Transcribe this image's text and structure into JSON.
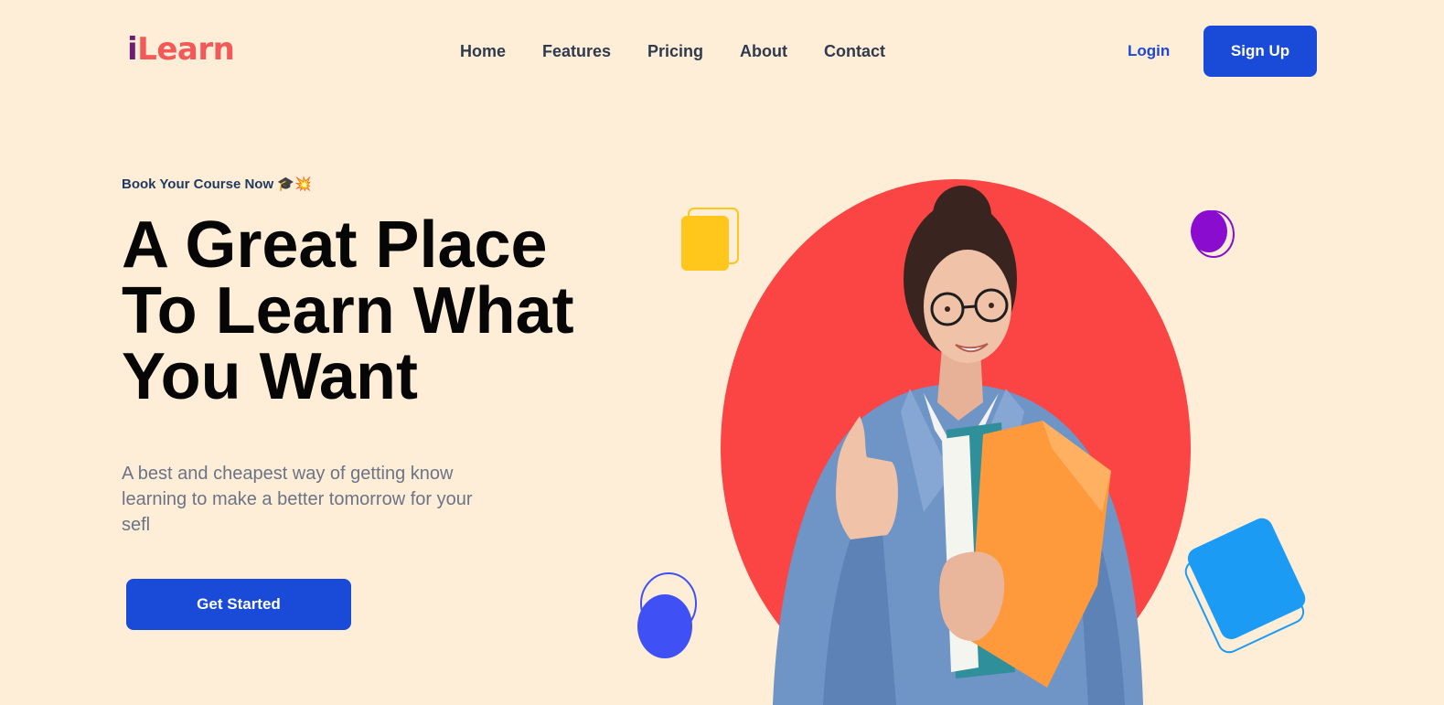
{
  "brand": {
    "logo_first": "i",
    "logo_rest": "Learn"
  },
  "nav": {
    "items": [
      "Home",
      "Features",
      "Pricing",
      "About",
      "Contact"
    ]
  },
  "auth": {
    "login_label": "Login",
    "signup_label": "Sign Up"
  },
  "hero": {
    "eyebrow": "Book Your Course Now 🎓💥",
    "headline_lines": [
      "A Great Place",
      "To Learn What",
      "You Want"
    ],
    "description": "A best and cheapest way of getting know learning to make a better tomorrow for your sefl",
    "cta_label": "Get Started"
  },
  "icons": {
    "student": "student-photo-icon",
    "square_yellow": "yellow-square-icon",
    "circle_purple": "purple-circle-icon",
    "circle_blue": "blue-circle-icon",
    "square_blue": "blue-square-icon"
  },
  "colors": {
    "background": "#ffeed7",
    "primary": "#1a4bd8",
    "logo_i": "#6b1f6e",
    "logo_rest": "#f25a5a",
    "hero_circle": "#fb4444"
  }
}
